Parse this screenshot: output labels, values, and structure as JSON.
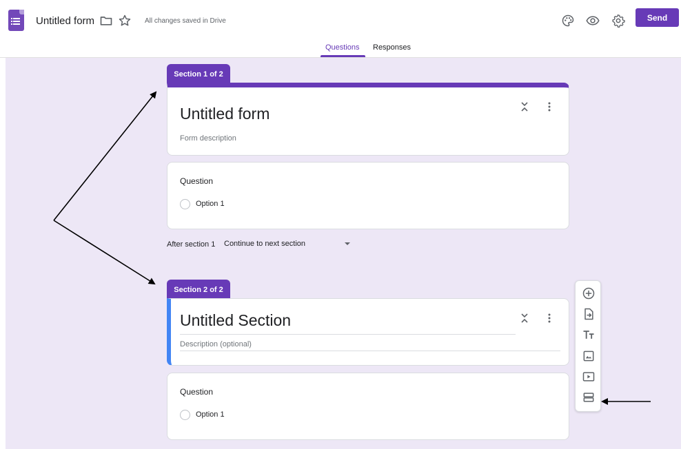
{
  "header": {
    "doc_title": "Untitled form",
    "save_status": "All changes saved in Drive",
    "send_label": "Send",
    "icons": [
      "forms-app-icon",
      "folder-icon",
      "star-icon",
      "palette-icon",
      "eye-icon",
      "gear-icon"
    ]
  },
  "tabs": {
    "questions": "Questions",
    "responses": "Responses",
    "active": "questions"
  },
  "section1": {
    "tag": "Section 1 of 2",
    "title": "Untitled form",
    "description": "Form description",
    "question": {
      "label": "Question",
      "option": "Option 1"
    },
    "after_label": "After section 1",
    "after_value": "Continue to next section"
  },
  "section2": {
    "tag": "Section 2 of 2",
    "title": "Untitled Section",
    "description": "Description (optional)",
    "question": {
      "label": "Question",
      "option": "Option 1"
    }
  },
  "toolbar": {
    "buttons": [
      "add-question-icon",
      "import-questions-icon",
      "add-title-icon",
      "add-image-icon",
      "add-video-icon",
      "add-section-icon"
    ]
  },
  "colors": {
    "accent": "#673ab7",
    "canvas": "#ede7f6",
    "section_highlight": "#4285f4"
  }
}
